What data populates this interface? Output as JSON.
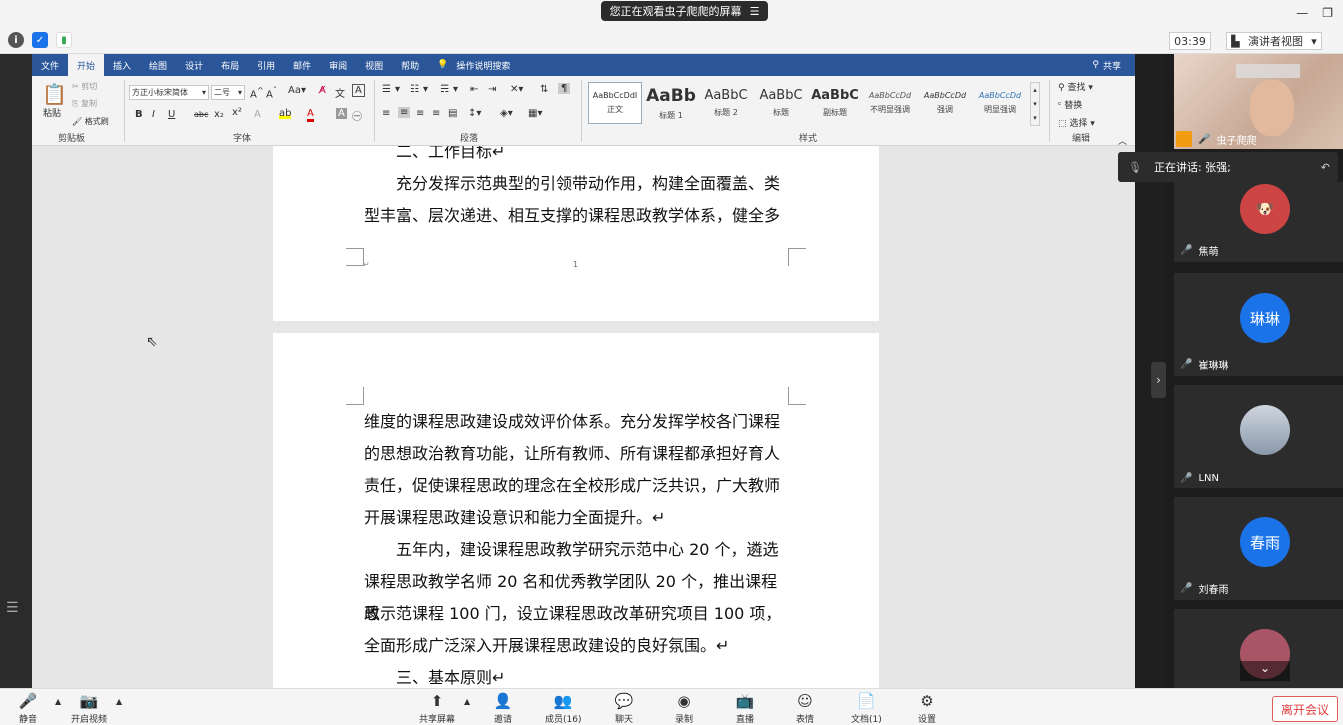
{
  "window": {
    "banner": "您正在观看虫子爬爬的屏幕",
    "banner_icon": "menu-icon"
  },
  "status": {
    "timer": "03:39",
    "view": "演讲者视图"
  },
  "word": {
    "tabs": [
      "文件",
      "开始",
      "插入",
      "绘图",
      "设计",
      "布局",
      "引用",
      "邮件",
      "审阅",
      "视图",
      "帮助"
    ],
    "active_tab": "开始",
    "search_hint": "操作说明搜索",
    "share": "共享",
    "clipboard": {
      "paste": "粘贴",
      "cut": "剪切",
      "copy": "复制",
      "painter": "格式刷",
      "label": "剪贴板"
    },
    "font": {
      "name": "方正小标宋简体",
      "size": "二号",
      "label": "字体"
    },
    "paragraph_label": "段落",
    "styles": [
      {
        "sample": "AaBbCcDdI",
        "name": "正文"
      },
      {
        "sample": "AaBb",
        "name": "标题 1"
      },
      {
        "sample": "AaBbC",
        "name": "标题 2"
      },
      {
        "sample": "AaBbC",
        "name": "标题"
      },
      {
        "sample": "AaBbC",
        "name": "副标题"
      },
      {
        "sample": "AaBbCcDd",
        "name": "不明显强调"
      },
      {
        "sample": "AaBbCcDd",
        "name": "强调"
      },
      {
        "sample": "AaBbCcDd",
        "name": "明显强调"
      }
    ],
    "styles_label": "样式",
    "editing": {
      "find": "查找",
      "replace": "替换",
      "select": "选择",
      "label": "编辑"
    }
  },
  "doc": {
    "page1": {
      "heading": "二、工作目标↵",
      "line1": "充分发挥示范典型的引领带动作用，构建全面覆盖、类",
      "line2": "型丰富、层次递进、相互支撑的课程思政教学体系，健全多",
      "page_number": "1",
      "footer_mark": "↵"
    },
    "page2": {
      "lines": [
        "维度的课程思政建设成效评价体系。充分发挥学校各门课程",
        "的思想政治教育功能，让所有教师、所有课程都承担好育人",
        "责任，促使课程思政的理念在全校形成广泛共识，广大教师",
        "开展课程思政建设意识和能力全面提升。↵"
      ],
      "lines2": [
        "五年内，建设课程思政教学研究示范中心 20 个，遴选",
        "课程思政教学名师 20 名和优秀教学团队 20 个，推出课程思",
        "政示范课程 100 门，设立课程思政改革研究项目 100 项，",
        "全面形成广泛深入开展课程思政建设的良好氛围。↵"
      ],
      "heading": "三、基本原则↵"
    }
  },
  "gallery": {
    "presenter": "虫子爬爬",
    "speaking": "正在讲话: 张强;",
    "participants": [
      {
        "name": "焦萌",
        "avatar_text": ""
      },
      {
        "name": "崔琳琳",
        "avatar_text": "琳琳",
        "color": "#1a73e8"
      },
      {
        "name": "LNN",
        "avatar_text": ""
      },
      {
        "name": "刘春雨",
        "avatar_text": "春雨",
        "color": "#1a73e8"
      }
    ]
  },
  "toolbar": {
    "mute": "静音",
    "video": "开启视频",
    "share": "共享屏幕",
    "invite": "邀请",
    "members": "成员(16)",
    "chat": "聊天",
    "record": "录制",
    "live": "直播",
    "emoji": "表情",
    "docs": "文档(1)",
    "settings": "设置",
    "leave": "离开会议"
  }
}
